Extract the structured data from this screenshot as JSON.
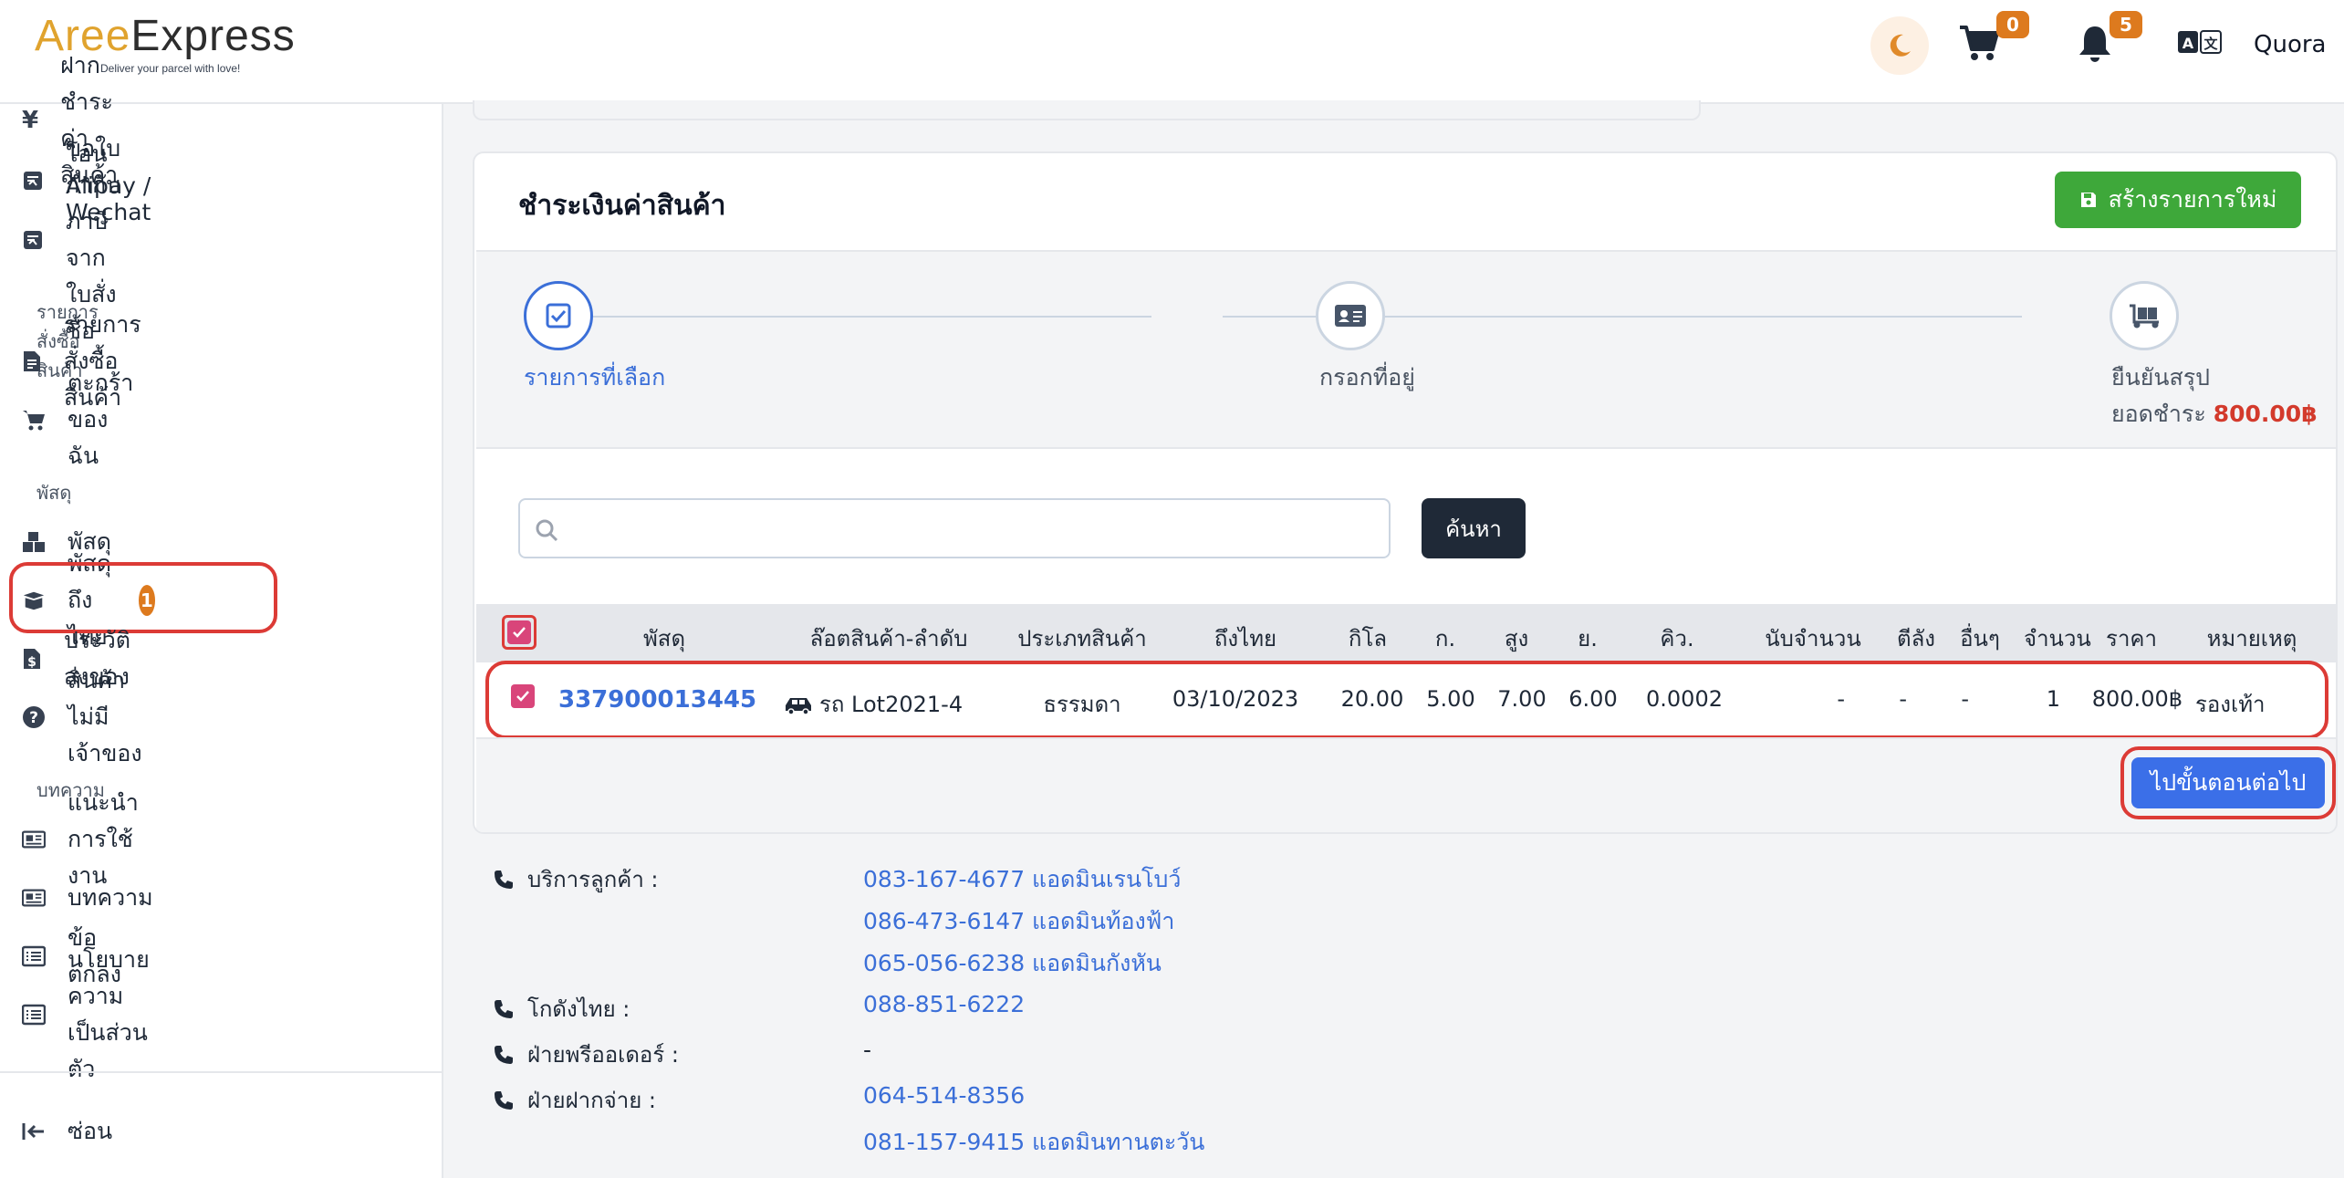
{
  "header": {
    "logo_left": "Aree",
    "logo_right": "Express",
    "tagline": "Deliver your parcel with love!",
    "cart_count": "0",
    "notification_count": "5",
    "user_name": "Quora"
  },
  "sidebar": {
    "items_top": [
      {
        "label": "ฝากชำระค่าสินค้า",
        "icon": "yen-icon"
      },
      {
        "label": "โอน Alipay / Wechat",
        "icon": "transfer-icon"
      },
      {
        "label": "ขอใบกำกับภาษีจากใบสั่งซื้อ",
        "icon": "invoice-icon"
      }
    ],
    "section_orders": "รายการสั่งซื้อสินค้า",
    "items_orders": [
      {
        "label": "รายการสั่งซื้อสินค้า",
        "icon": "document-icon"
      },
      {
        "label": "ตะกร้าของฉัน",
        "icon": "cart-icon"
      }
    ],
    "section_parcels": "พัสดุ",
    "items_parcels": [
      {
        "label": "พัสดุ",
        "icon": "boxes-icon"
      },
      {
        "label": "พัสดุถึงไทย",
        "icon": "open-box-icon",
        "badge": "1"
      },
      {
        "label": "ประวัติส่งของ",
        "icon": "receipt-icon"
      },
      {
        "label": "สินค้าไม่มีเจ้าของ",
        "icon": "question-icon"
      }
    ],
    "section_articles": "บทความ",
    "items_articles": [
      {
        "label": "แนะนำการใช้งาน",
        "icon": "newspaper-icon"
      },
      {
        "label": "บทความ",
        "icon": "newspaper-icon"
      },
      {
        "label": "ข้อตกลง",
        "icon": "list-icon"
      },
      {
        "label": "นโยบายความเป็นส่วนตัว",
        "icon": "list-icon"
      }
    ],
    "collapse_label": "ซ่อน"
  },
  "main": {
    "title": "ชำระเงินค่าสินค้า",
    "new_button": "สร้างรายการใหม่",
    "steps": [
      {
        "label": "รายการที่เลือก",
        "active": true
      },
      {
        "label": "กรอกที่อยู่",
        "active": false
      },
      {
        "label": "ยืนยันสรุป",
        "active": false
      }
    ],
    "total_label": "ยอดชำระ",
    "total_value": "800.00฿",
    "search": {
      "placeholder": "",
      "value": "",
      "button": "ค้นหา"
    },
    "table": {
      "headers": [
        "พัสดุ",
        "ล๊อตสินค้า-ลำดับ",
        "ประเภทสินค้า",
        "ถึงไทย",
        "กิโล",
        "ก.",
        "สูง",
        "ย.",
        "คิว.",
        "นับจำนวน",
        "ตีลัง",
        "อื่นๆ",
        "จำนวน",
        "ราคา",
        "หมายเหตุ"
      ],
      "rows": [
        {
          "tracking": "337900013445",
          "lot": "รถ Lot2021-4",
          "type": "ธรรมดา",
          "arrived": "03/10/2023",
          "kg": "20.00",
          "width": "5.00",
          "height": "7.00",
          "length": "6.00",
          "cbm": "0.0002",
          "count_fee": "-",
          "crate": "-",
          "other": "-",
          "qty": "1",
          "price": "800.00฿",
          "note": "รองเท้า"
        }
      ]
    },
    "next_button": "ไปขั้นตอนต่อไป"
  },
  "contacts": {
    "customer_service": {
      "label": "บริการลูกค้า :",
      "values": [
        "083-167-4677 แอดมินเรนโบว์",
        "086-473-6147 แอดมินท้องฟ้า",
        "065-056-6238 แอดมินกังหัน"
      ]
    },
    "warehouse_thai": {
      "label": "โกดังไทย :",
      "values": [
        "088-851-6222"
      ]
    },
    "preorder": {
      "label": "ฝ่ายพรีออเดอร์ :",
      "values": [
        "-"
      ]
    },
    "deposit": {
      "label": "ฝ่ายฝากจ่าย :",
      "values": [
        "064-514-8356",
        "081-157-9415 แอดมินทานตะวัน"
      ]
    }
  },
  "colors": {
    "accent": "#3b6fd8",
    "brand": "#e0a32e",
    "badge": "#dd7a1e",
    "success": "#3ea83a",
    "highlight": "#dc3b36"
  }
}
